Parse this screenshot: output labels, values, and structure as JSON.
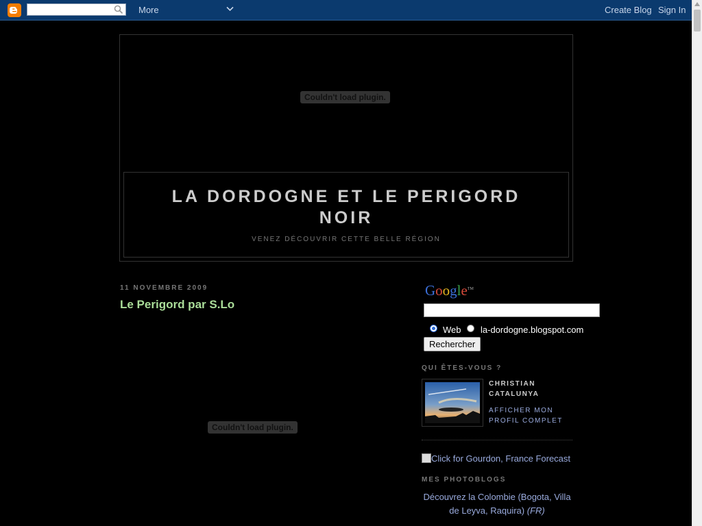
{
  "navbar": {
    "search_value": "",
    "more_label": "More",
    "create_blog_label": "Create Blog",
    "sign_in_label": "Sign In"
  },
  "header": {
    "plugin_message": "Couldn't load plugin.",
    "title": "LA DORDOGNE ET LE PERIGORD NOIR",
    "description": "VENEZ DÉCOUVRIR CETTE BELLE RÉGION"
  },
  "main": {
    "date_header": "11 NOVEMBRE 2009",
    "post_title": "Le Perigord par S.Lo",
    "plugin_message": "Couldn't load plugin."
  },
  "sidebar": {
    "google_search": {
      "logo_text": "Google",
      "logo_tm": "TM",
      "query_value": "",
      "option_web": "Web",
      "option_site": "la-dordogne.blogspot.com",
      "selected": "Web",
      "button_label": "Rechercher"
    },
    "profile": {
      "heading": "QUI ÊTES-VOUS ?",
      "name": "CHRISTIAN CATALUNYA",
      "link": "AFFICHER MON PROFIL COMPLET"
    },
    "forecast_alt": "Click for Gourdon, France Forecast",
    "photoblogs": {
      "heading": "MES PHOTOBLOGS",
      "link_text": "Découvrez la Colombie (Bogota, Villa de Leyva, Raquira)",
      "link_suffix": "(FR)"
    }
  },
  "colors": {
    "navbar_bg": "#0b3a6e",
    "page_bg": "#000000",
    "post_title": "#aadd99",
    "link": "#99aadd",
    "blogger_orange": "#f57d00"
  }
}
